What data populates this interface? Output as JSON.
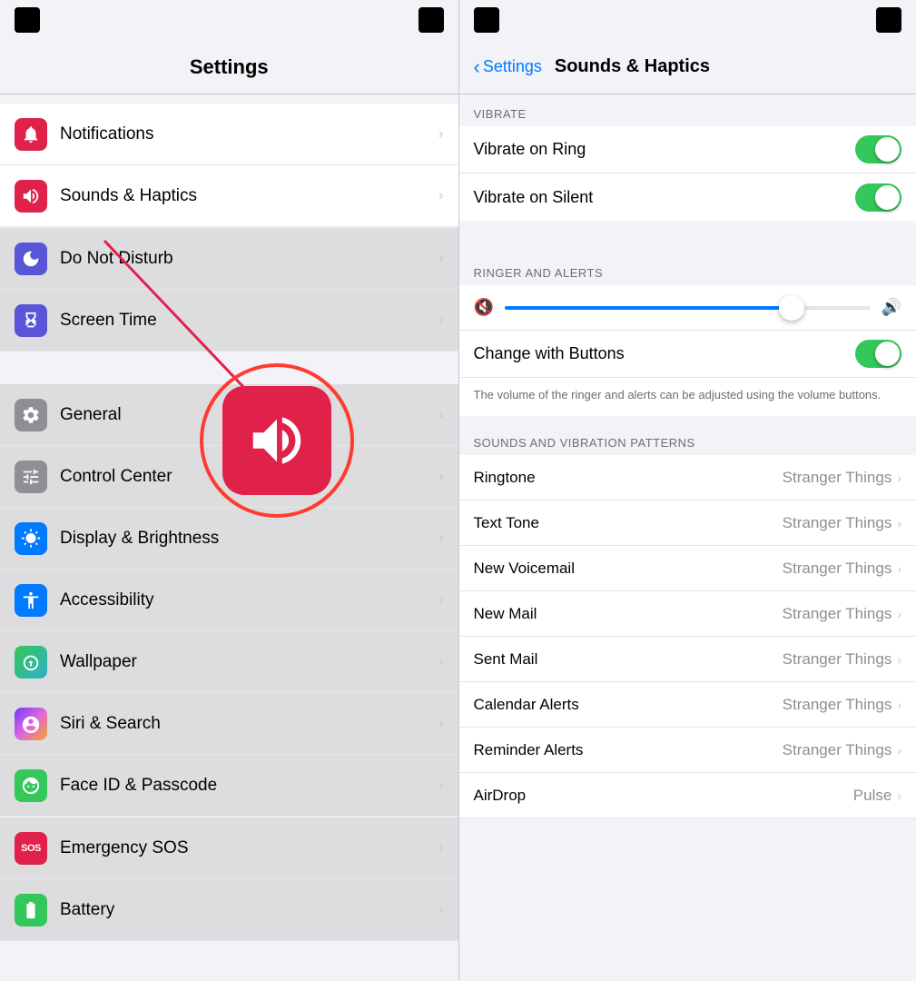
{
  "left": {
    "title": "Settings",
    "items": [
      {
        "id": "notifications",
        "label": "Notifications",
        "iconBg": "#e0214a",
        "iconType": "bell",
        "active": false,
        "grayed": true
      },
      {
        "id": "sounds",
        "label": "Sounds & Haptics",
        "iconBg": "#e0214a",
        "iconType": "speaker",
        "active": true,
        "grayed": false
      },
      {
        "id": "donotdisturb",
        "label": "Do Not Disturb",
        "iconBg": "#5856d6",
        "iconType": "moon",
        "active": false,
        "grayed": true
      },
      {
        "id": "screentime",
        "label": "Screen Time",
        "iconBg": "#5856d6",
        "iconType": "hourglass",
        "active": false,
        "grayed": true
      },
      {
        "id": "general",
        "label": "General",
        "iconBg": "#8e8e93",
        "iconType": "gear",
        "active": false,
        "grayed": true
      },
      {
        "id": "controlcenter",
        "label": "Control Center",
        "iconBg": "#8e8e93",
        "iconType": "sliders",
        "active": false,
        "grayed": true
      },
      {
        "id": "displaybrightness",
        "label": "Display & Brightness",
        "iconBg": "#007aff",
        "iconType": "sun",
        "active": false,
        "grayed": true
      },
      {
        "id": "accessibility",
        "label": "Accessibility",
        "iconBg": "#007aff",
        "iconType": "person-circle",
        "active": false,
        "grayed": true
      },
      {
        "id": "wallpaper",
        "label": "Wallpaper",
        "iconBg": "#34c759",
        "iconType": "flower",
        "active": false,
        "grayed": true
      },
      {
        "id": "siri",
        "label": "Siri & Search",
        "iconBg": "#000",
        "iconType": "siri",
        "active": false,
        "grayed": true
      },
      {
        "id": "faceid",
        "label": "Face ID & Passcode",
        "iconBg": "#34c759",
        "iconType": "face",
        "active": false,
        "grayed": true
      },
      {
        "id": "sos",
        "label": "Emergency SOS",
        "iconBg": "#e0214a",
        "iconType": "sos",
        "active": false,
        "grayed": true
      },
      {
        "id": "battery",
        "label": "Battery",
        "iconBg": "#34c759",
        "iconType": "battery",
        "active": false,
        "grayed": true
      }
    ]
  },
  "right": {
    "back_label": "Settings",
    "title": "Sounds & Haptics",
    "sections": {
      "vibrate_header": "VIBRATE",
      "vibrate_on_ring_label": "Vibrate on Ring",
      "vibrate_on_ring_value": true,
      "vibrate_on_silent_label": "Vibrate on Silent",
      "vibrate_on_silent_value": true,
      "ringer_header": "RINGER AND ALERTS",
      "slider_value": 78,
      "change_buttons_label": "Change with Buttons",
      "change_buttons_value": true,
      "change_buttons_info": "The volume of the ringer and alerts can be adjusted using the volume buttons.",
      "sounds_header": "SOUNDS AND VIBRATION PATTERNS",
      "sound_items": [
        {
          "label": "Ringtone",
          "value": "Stranger Things"
        },
        {
          "label": "Text Tone",
          "value": "Stranger Things"
        },
        {
          "label": "New Voicemail",
          "value": "Stranger Things"
        },
        {
          "label": "New Mail",
          "value": "Stranger Things"
        },
        {
          "label": "Sent Mail",
          "value": "Stranger Things"
        },
        {
          "label": "Calendar Alerts",
          "value": "Stranger Things"
        },
        {
          "label": "Reminder Alerts",
          "value": "Stranger Things"
        },
        {
          "label": "AirDrop",
          "value": "Pulse"
        }
      ]
    }
  }
}
